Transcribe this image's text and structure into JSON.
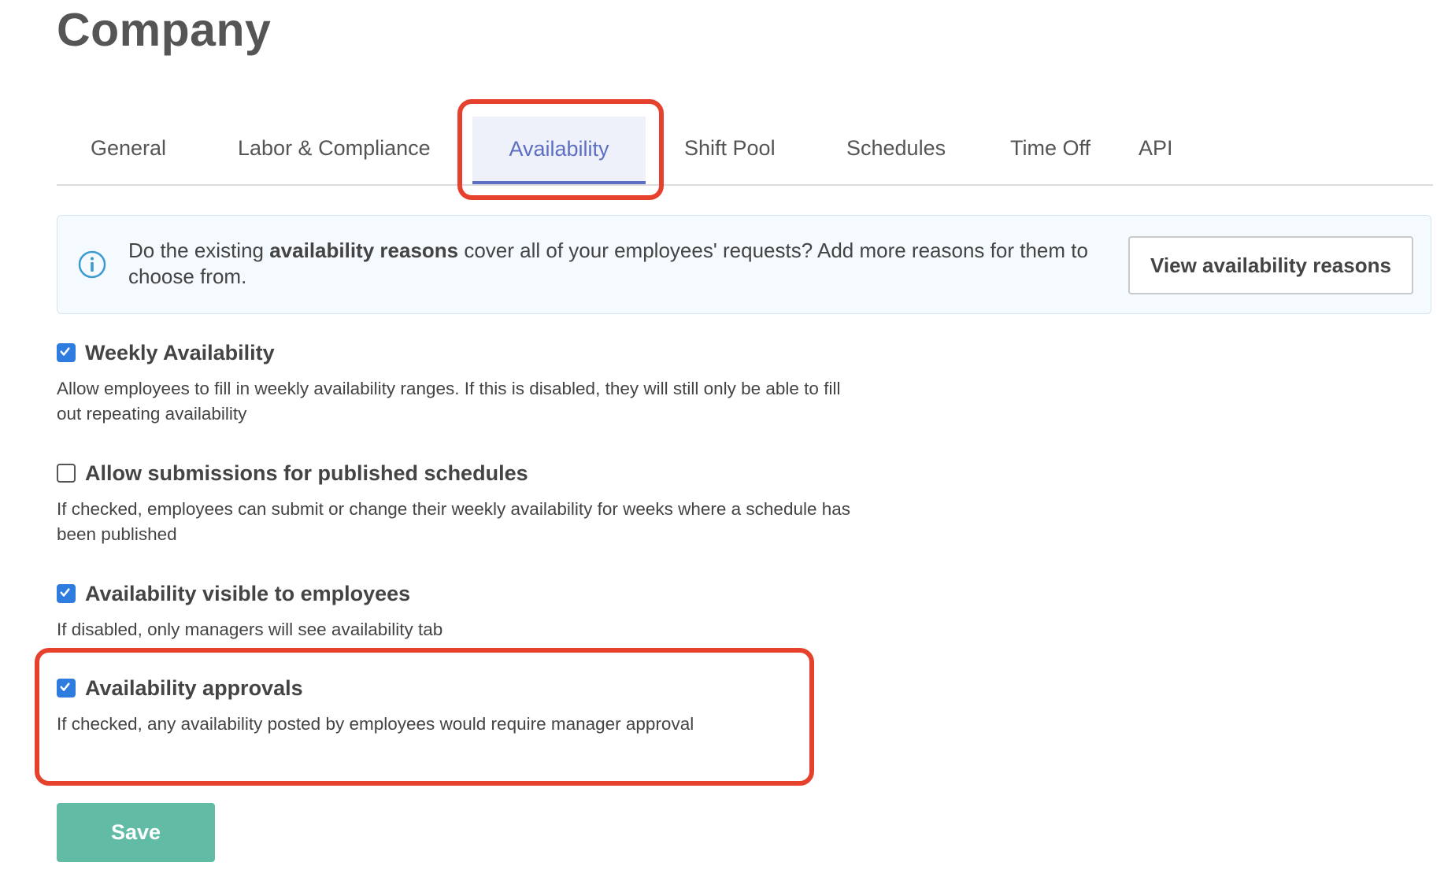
{
  "page": {
    "title": "Company"
  },
  "tabs": [
    {
      "label": "General",
      "active": false
    },
    {
      "label": "Labor & Compliance",
      "active": false
    },
    {
      "label": "Availability",
      "active": true
    },
    {
      "label": "Shift Pool",
      "active": false
    },
    {
      "label": "Schedules",
      "active": false
    },
    {
      "label": "Time Off",
      "active": false
    },
    {
      "label": "API",
      "active": false
    }
  ],
  "info_banner": {
    "text_prefix": "Do the existing ",
    "text_bold": "availability reasons",
    "text_suffix": " cover all of your employees' requests? Add more reasons for them to choose from.",
    "button_label": "View availability reasons",
    "icon": "info-icon"
  },
  "settings": [
    {
      "label": "Weekly Availability",
      "checked": true,
      "description": "Allow employees to fill in weekly availability ranges. If this is disabled, they will still only be able to fill out repeating availability"
    },
    {
      "label": "Allow submissions for published schedules",
      "checked": false,
      "description": "If checked, employees can submit or change their weekly availability for weeks where a schedule has been published"
    },
    {
      "label": "Availability visible to employees",
      "checked": true,
      "description": "If disabled, only managers will see availability tab"
    },
    {
      "label": "Availability approvals",
      "checked": true,
      "description": "If checked, any availability posted by employees would require manager approval"
    }
  ],
  "actions": {
    "save_label": "Save"
  },
  "colors": {
    "accent": "#5c6fc3",
    "checkbox": "#2f7ce0",
    "save": "#61bba5",
    "highlight": "#e5412d",
    "banner_bg": "#f4fafd"
  }
}
